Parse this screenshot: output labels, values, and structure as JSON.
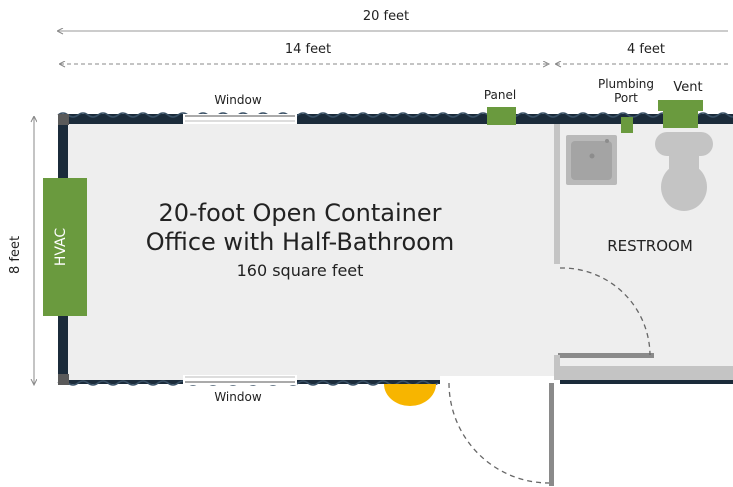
{
  "dimensions": {
    "total_width": "20 feet",
    "office_width": "14 feet",
    "restroom_width": "4 feet",
    "depth": "8 feet"
  },
  "labels": {
    "title_line1": "20-foot Open Container",
    "title_line2": "Office with Half-Bathroom",
    "area": "160 square feet",
    "window_top": "Window",
    "window_bottom": "Window",
    "panel": "Panel",
    "plumbing_line1": "Plumbing",
    "plumbing_line2": "Port",
    "vent": "Vent",
    "hvac": "HVAC",
    "restroom": "RESTROOM"
  },
  "colors": {
    "fixture_green": "#6a9a3e",
    "wall_blue": "#1b2b3a",
    "floor": "#eeeeee",
    "partition": "#c4c4c4",
    "light_yellow": "#f7b500"
  }
}
